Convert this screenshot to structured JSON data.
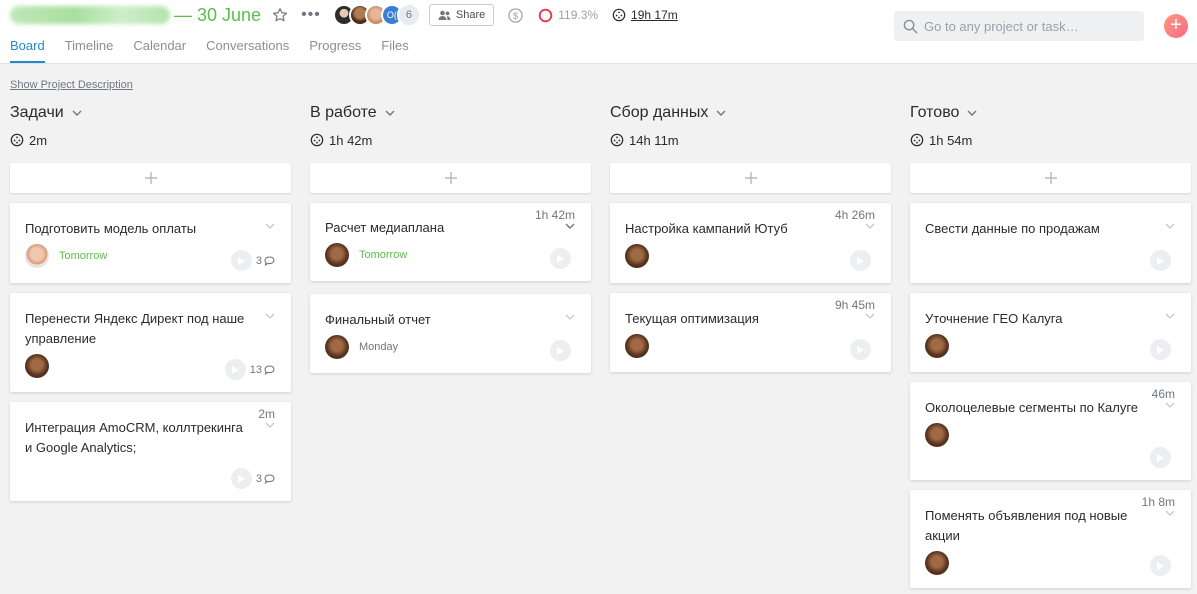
{
  "project": {
    "title_suffix": "— 30 June",
    "member_count": "6",
    "member_initials": "O("
  },
  "header": {
    "share_label": "Share",
    "progress_value": "119.3%",
    "time_total": "19h 17m",
    "search_placeholder": "Go to any project or task…",
    "add_symbol": "+"
  },
  "tabs": [
    "Board",
    "Timeline",
    "Calendar",
    "Conversations",
    "Progress",
    "Files"
  ],
  "show_description": "Show Project Description",
  "columns": [
    {
      "title": "Задачи",
      "time": "2m",
      "cards": [
        {
          "name": "Подготовить модель оплаты",
          "due": "Tomorrow",
          "comments": "3"
        },
        {
          "name": "Перенести Яндекс Директ под наше управление",
          "comments": "13"
        },
        {
          "name": "Интеграция AmoCRM, коллтрекинга и Google Analytics;",
          "duration": "2m",
          "comments": "3"
        }
      ]
    },
    {
      "title": "В работе",
      "time": "1h 42m",
      "cards": [
        {
          "name": "Расчет медиаплана",
          "duration": "1h 42m",
          "due": "Tomorrow"
        },
        {
          "name": "Финальный отчет",
          "due": "Monday"
        }
      ]
    },
    {
      "title": "Сбор данных",
      "time": "14h 11m",
      "cards": [
        {
          "name": "Настройка кампаний Ютуб",
          "duration": "4h 26m"
        },
        {
          "name": "Текущая оптимизация",
          "duration": "9h 45m"
        }
      ]
    },
    {
      "title": "Готово",
      "time": "1h 54m",
      "cards": [
        {
          "name": "Свести данные по продажам"
        },
        {
          "name": "Уточнение ГЕО Калуга"
        },
        {
          "name": "Околоцелевые сегменты по Калуге",
          "duration": "46m"
        },
        {
          "name": "Поменять объявления под новые акции",
          "duration": "1h 8m"
        }
      ]
    }
  ],
  "colors": {
    "accent": "#1f8ad0",
    "date_green": "#5bbf4c",
    "progress_ring": "#e8384f"
  }
}
